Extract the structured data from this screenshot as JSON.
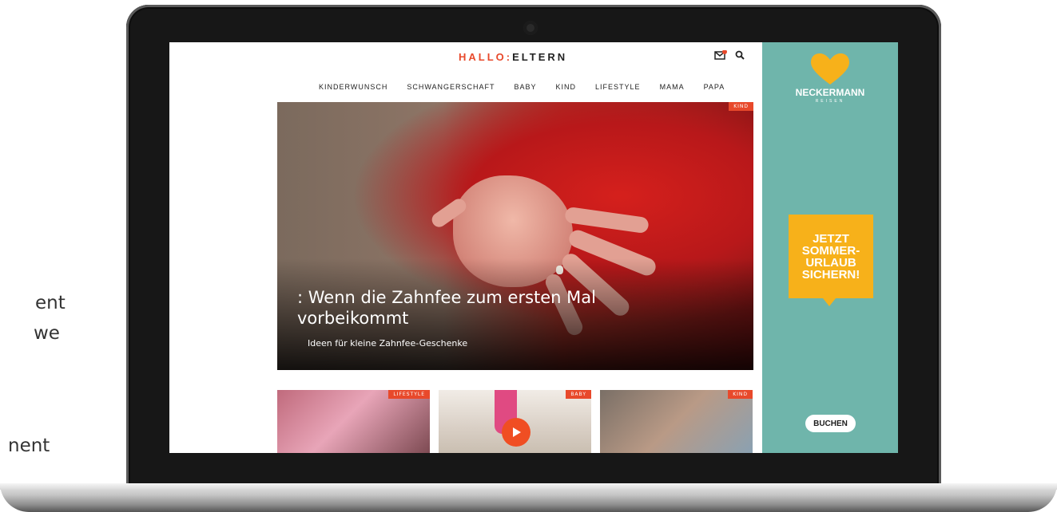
{
  "side_text": [
    "ent",
    "we",
    "nent"
  ],
  "site": {
    "logo_first": "HALLO",
    "logo_sep": ":",
    "logo_second": "ELTERN",
    "icons": [
      "mail-icon",
      "search-icon"
    ],
    "accent": "#e8492b"
  },
  "nav": [
    "KINDERWUNSCH",
    "SCHWANGERSCHAFT",
    "BABY",
    "KIND",
    "LIFESTYLE",
    "MAMA",
    "PAPA"
  ],
  "hero": {
    "badge": "KIND",
    "title_prefix": ":",
    "title": "Wenn die Zahnfee zum ersten Mal vorbeikommt",
    "subtitle": "Ideen für kleine Zahnfee-Geschenke"
  },
  "cards": [
    {
      "badge": "LIFESTYLE"
    },
    {
      "badge": "BABY",
      "icon": "play-icon"
    },
    {
      "badge": "KIND"
    }
  ],
  "ad": {
    "brand": "NECKERMANN",
    "brand_sub": "REISEN",
    "cta_text": "JETZT\nSOMMER-\nURLAUB\nSICHERN!",
    "button": "BUCHEN",
    "bg_color": "#6fb5ab",
    "cta_color": "#f7b11a"
  }
}
